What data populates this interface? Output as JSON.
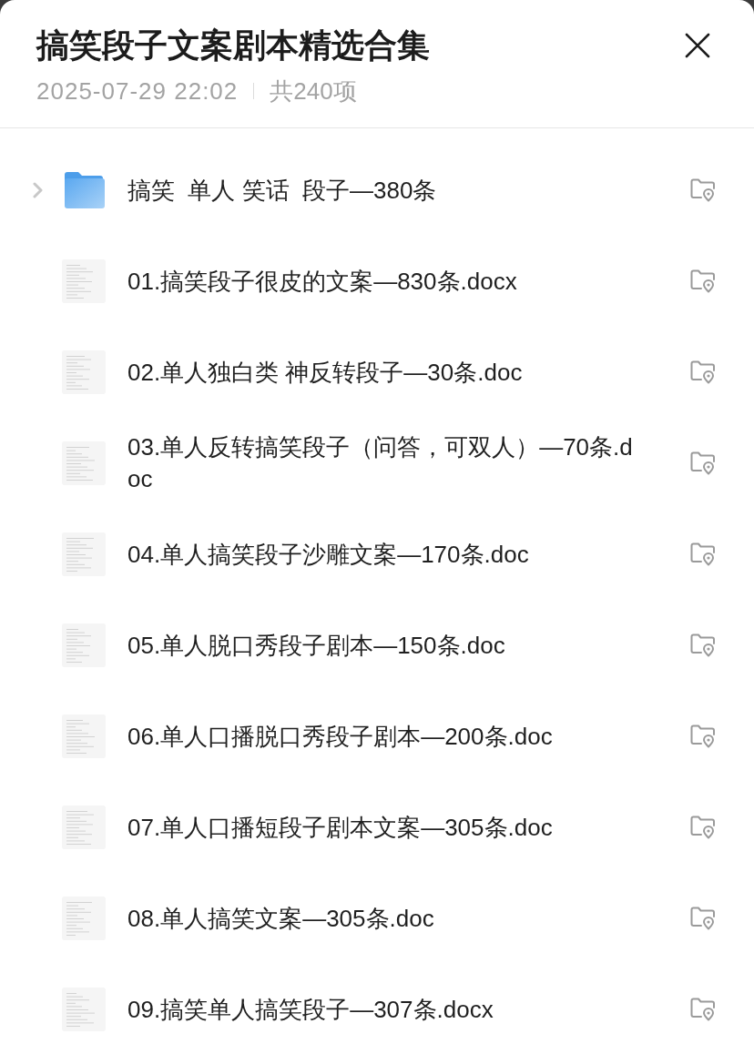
{
  "header": {
    "title": "搞笑段子文案剧本精选合集",
    "date": "2025-07-29 22:02",
    "count": "共240项"
  },
  "items": [
    {
      "kind": "folder",
      "name": "搞笑  单人 笑话  段子—380条",
      "expanded": false
    },
    {
      "kind": "doc",
      "name": "01.搞笑段子很皮的文案—830条.docx"
    },
    {
      "kind": "doc",
      "name": "02.单人独白类 神反转段子—30条.doc"
    },
    {
      "kind": "doc",
      "name": "03.单人反转搞笑段子（问答，可双人）—70条.doc"
    },
    {
      "kind": "doc",
      "name": "04.单人搞笑段子沙雕文案—170条.doc"
    },
    {
      "kind": "doc",
      "name": "05.单人脱口秀段子剧本—150条.doc"
    },
    {
      "kind": "doc",
      "name": "06.单人口播脱口秀段子剧本—200条.doc"
    },
    {
      "kind": "doc",
      "name": "07.单人口播短段子剧本文案—305条.doc"
    },
    {
      "kind": "doc",
      "name": "08.单人搞笑文案—305条.doc"
    },
    {
      "kind": "doc",
      "name": "09.搞笑单人搞笑段子—307条.docx"
    }
  ]
}
